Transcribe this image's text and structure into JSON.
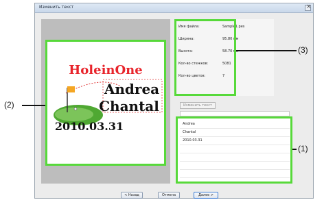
{
  "window": {
    "title": "Изменить текст"
  },
  "preview": {
    "title_text": "HoleinOne",
    "names": [
      "Andrea",
      "Chantal"
    ],
    "date": "2010.03.31",
    "colors": {
      "title": "#e8242b",
      "text": "#111111",
      "flag": "#f5a623",
      "green": "#4fa832",
      "dashed": "#e03a3a"
    }
  },
  "info": {
    "rows": [
      {
        "label": "Имя файла:",
        "value": "Sample1.pes"
      },
      {
        "label": "Ширина:",
        "value": "95.80 мм"
      },
      {
        "label": "Высота:",
        "value": "58.70 мм"
      },
      {
        "label": "Кол-во стежков:",
        "value": "5081"
      },
      {
        "label": "Кол-во цветов:",
        "value": "7"
      }
    ]
  },
  "edit_button": {
    "label": "Изменить текст"
  },
  "list": {
    "items": [
      "Andrea",
      "Chantal",
      "2010.03.31"
    ]
  },
  "buttons": {
    "back": "< Назад",
    "cancel": "Отмена",
    "next": "Далее >"
  },
  "callouts": {
    "c1": "(1)",
    "c2": "(2)",
    "c3": "(3)"
  },
  "highlight_color": "#57d93a"
}
